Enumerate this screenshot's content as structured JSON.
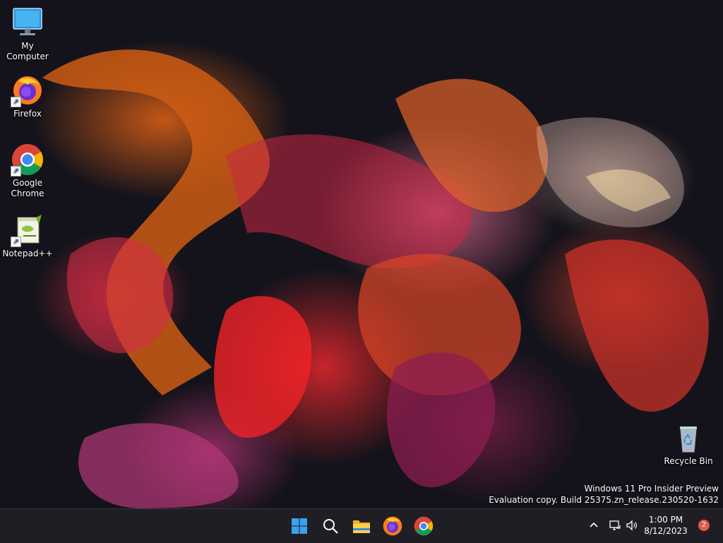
{
  "desktop": {
    "icons": [
      {
        "label": "My Computer",
        "icon": "monitor-icon"
      },
      {
        "label": "Firefox",
        "icon": "firefox-icon"
      },
      {
        "label": "Google Chrome",
        "icon": "chrome-icon"
      },
      {
        "label": "Notepad++",
        "icon": "notepad-plus-plus-icon"
      },
      {
        "label": "Recycle Bin",
        "icon": "recycle-bin-icon"
      }
    ],
    "watermark": {
      "line1": "Windows 11 Pro Insider Preview",
      "line2": "Evaluation copy. Build 25375.zn_release.230520-1632"
    }
  },
  "taskbar": {
    "apps": [
      "start-icon",
      "search-icon",
      "file-explorer-icon",
      "firefox-icon",
      "chrome-icon"
    ],
    "tray": {
      "time": "1:00 PM",
      "date": "8/12/2023",
      "notification_count": "2"
    }
  },
  "colors": {
    "taskbar": "#1e1e24",
    "start_blue": "#3aa0f0",
    "badge": "#e35a4c"
  }
}
